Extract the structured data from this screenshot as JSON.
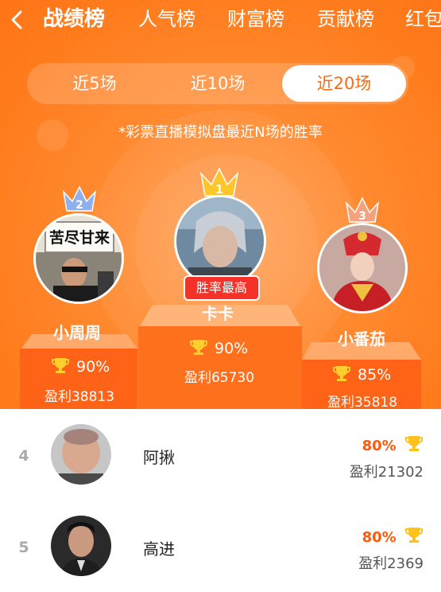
{
  "header": {
    "back_icon": "chevron-left-icon",
    "tabs": [
      {
        "label": "战绩榜",
        "active": true
      },
      {
        "label": "人气榜",
        "active": false
      },
      {
        "label": "财富榜",
        "active": false
      },
      {
        "label": "贡献榜",
        "active": false
      },
      {
        "label": "红包",
        "active": false
      }
    ]
  },
  "segments": {
    "items": [
      {
        "label": "近5场",
        "active": false
      },
      {
        "label": "近10场",
        "active": false
      },
      {
        "label": "近20场",
        "active": true
      }
    ]
  },
  "note": "*彩票直播模拟盘最近N场的胜率",
  "podium": {
    "best_badge": "胜率最高",
    "first": {
      "rank": "1",
      "name": "卡卡",
      "rate": "90%",
      "profit": "盈利65730"
    },
    "second": {
      "rank": "2",
      "name": "小周周",
      "rate": "90%",
      "profit": "盈利38813",
      "avatar_text": "苦尽甘来"
    },
    "third": {
      "rank": "3",
      "name": "小番茄",
      "rate": "85%",
      "profit": "盈利35818"
    }
  },
  "list": [
    {
      "rank": "4",
      "name": "阿揪",
      "rate": "80%",
      "profit": "盈利21302"
    },
    {
      "rank": "5",
      "name": "高进",
      "rate": "80%",
      "profit": "盈利2369"
    }
  ],
  "colors": {
    "primary": "#ff7c1d",
    "accent_red": "#f5322a",
    "rate_text": "#ff5a0a",
    "gold": "#ffcf2e"
  }
}
